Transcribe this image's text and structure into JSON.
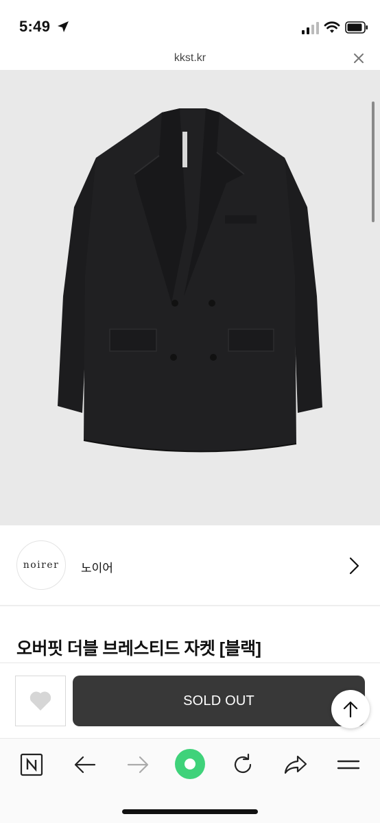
{
  "status_bar": {
    "time": "5:49"
  },
  "url_bar": {
    "url": "kkst.kr"
  },
  "product_image": {
    "alt": "오버핏 더블 브레스티드 자켓 [블랙]"
  },
  "brand": {
    "logo_text": "noirer",
    "name": "노이어"
  },
  "product": {
    "title": "오버핏 더블 브레스티드 자켓 [블랙]"
  },
  "actions": {
    "sold_out_label": "SOLD OUT"
  },
  "colors": {
    "hero_background": "#e9e9e9",
    "sold_out_button": "#383838",
    "refresh_accent": "#3fd27a"
  },
  "toolbar": {
    "items": [
      "naver-n-icon",
      "back-arrow-icon",
      "forward-arrow-icon",
      "green-dot-icon",
      "refresh-icon",
      "share-icon",
      "menu-icon"
    ]
  }
}
